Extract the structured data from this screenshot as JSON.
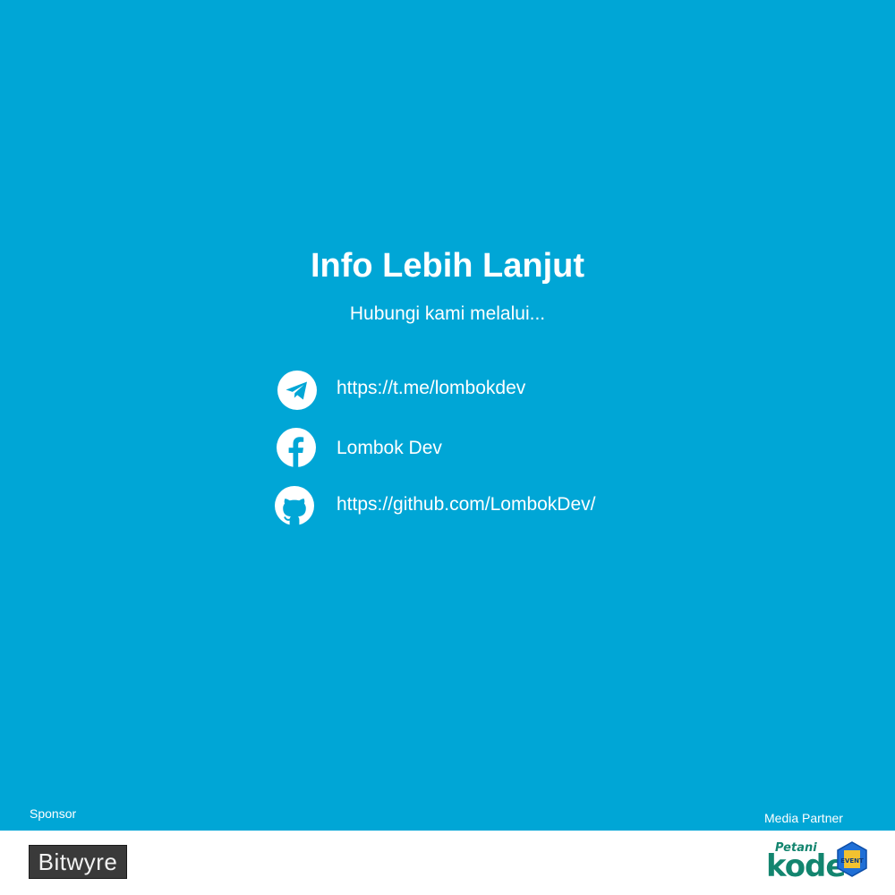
{
  "header": {
    "title": "Info Lebih Lanjut",
    "subtitle": "Hubungi kami melalui..."
  },
  "contacts": [
    {
      "icon": "telegram-icon",
      "text": "https://t.me/lombokdev"
    },
    {
      "icon": "facebook-icon",
      "text": "Lombok Dev"
    },
    {
      "icon": "github-icon",
      "text": "https://github.com/LombokDev/"
    }
  ],
  "footer": {
    "sponsor_label": "Sponsor",
    "media_partner_label": "Media Partner",
    "sponsor_logo": {
      "name": "Bitwyre",
      "icon": "bitwyre-logo"
    },
    "media_partner_logo": {
      "top": "Petani",
      "main": "kode",
      "badge": "EVENT",
      "icon": "petanikode-logo"
    }
  },
  "colors": {
    "background": "#00A6D6",
    "text": "#FFFFFF",
    "footer_background": "#FFFFFF",
    "brand_green": "#13856F"
  }
}
